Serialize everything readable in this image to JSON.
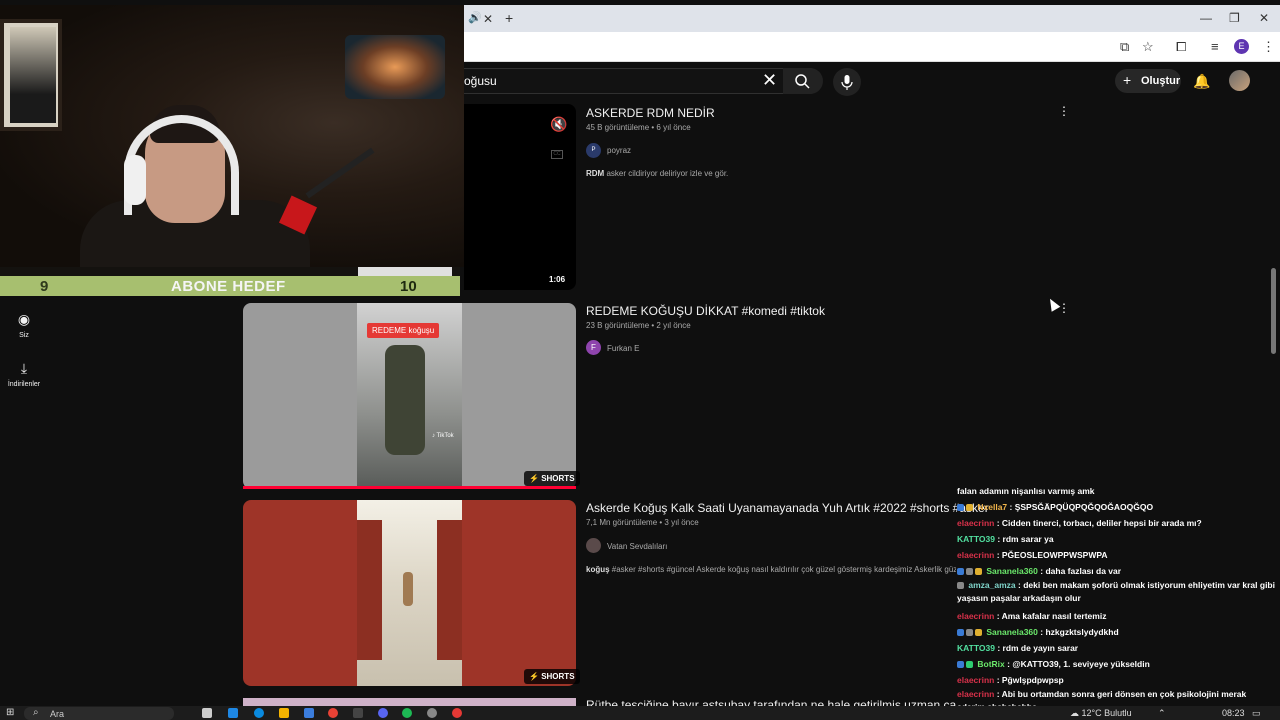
{
  "browser": {
    "tab_close": "✕",
    "new_tab": "+",
    "profile_letter": "E"
  },
  "youtube": {
    "search_text": "oğusu",
    "create_label": "Oluştur"
  },
  "stream_overlay": {
    "goal_current": "9",
    "goal_title": "ABONE HEDEF",
    "goal_target": "10"
  },
  "left_nav": {
    "items": [
      {
        "label": "Siz",
        "icon": "user-circle-icon"
      },
      {
        "label": "İndirilenler",
        "icon": "download-icon"
      }
    ]
  },
  "videos": [
    {
      "title": "ASKERDE RDM NEDİR",
      "views": "45 B görüntüleme",
      "age": "6 yıl önce",
      "channel": "poyraz",
      "desc_bold": "RDM",
      "desc_rest": " asker cildiriyor deliriyor izle ve gör.",
      "duration": "1:06"
    },
    {
      "title": "REDEME KOĞUŞU DİKKAT #komedi #tiktok",
      "views": "23 B görüntüleme",
      "age": "2 yıl önce",
      "channel": "Furkan E",
      "channel_initial": "F",
      "thumb_tag": "REDEME koğuşu",
      "thumb_watermark": "♪ TikTok",
      "badge": "SHORTS"
    },
    {
      "title": "Askerde Koğuş Kalk Saati Uyanamayanada Yuh Artık #2022 #shorts #asker",
      "views": "7,1 Mn görüntüleme",
      "age": "3 yıl önce",
      "channel": "Vatan Sevdalıları",
      "desc_bold": "koğuş",
      "desc_rest": " #asker #shorts #güncel Askerde koğuş nasıl kaldırılır çok güzel göstermiş kardeşimiz Askerlik güze",
      "badge": "SHORTS"
    },
    {
      "title": "Rütbe teşçiğine bayır astsubay tarafından ne hale getirilmiş uzman çavuşlar",
      "views": "",
      "age": ""
    }
  ],
  "chat": [
    {
      "user": "",
      "msg": "falan adamın nişanlısı varmış amk",
      "color": "#ffffff"
    },
    {
      "user": "Nxella7",
      "msg": "ŞSPSĞÄPQÜQPQĞQOĞAOQĞQO",
      "color": "#f0b44a"
    },
    {
      "user": "elaecrinn",
      "msg": "Cidden tinerci, torbacı, deliler hepsi bir arada mı?",
      "color": "#d8314a"
    },
    {
      "user": "KATTO39",
      "msg": "rdm sarar ya",
      "color": "#52e0a0"
    },
    {
      "user": "elaecrinn",
      "msg": "PĞEOSLEOWPPWSPWPA",
      "color": "#d8314a"
    },
    {
      "user": "Sananela360",
      "msg": "daha fazlası da var",
      "color": "#6be86b"
    },
    {
      "user": "amza_amza",
      "msg": "deki ben makam şoforü olmak istiyorum ehliyetim var kral gibi yaşasın paşalar arkadaşın olur",
      "color": "#7fd3c9"
    },
    {
      "user": "elaecrinn",
      "msg": "Ama kafalar nasıl tertemiz",
      "color": "#d8314a"
    },
    {
      "user": "Sananela360",
      "msg": "hzkgzktslydydkhd",
      "color": "#6be86b"
    },
    {
      "user": "KATTO39",
      "msg": "rdm de yayın sarar",
      "color": "#52e0a0"
    },
    {
      "user": "BotRix",
      "msg": "@KATTO39, 1. seviyeye yükseldin",
      "color": "#6be86b"
    },
    {
      "user": "elaecrinn",
      "msg": "Pğwlşpdpwpsp",
      "color": "#d8314a"
    },
    {
      "user": "elaecrinn",
      "msg": "Abi bu ortamdan sonra geri dönsen en çok psikolojini merak ederim ahshahahha",
      "color": "#d8314a"
    }
  ],
  "taskbar": {
    "search_label": "Ara",
    "weather": "12°C  Bulutlu",
    "time": "08:23"
  }
}
